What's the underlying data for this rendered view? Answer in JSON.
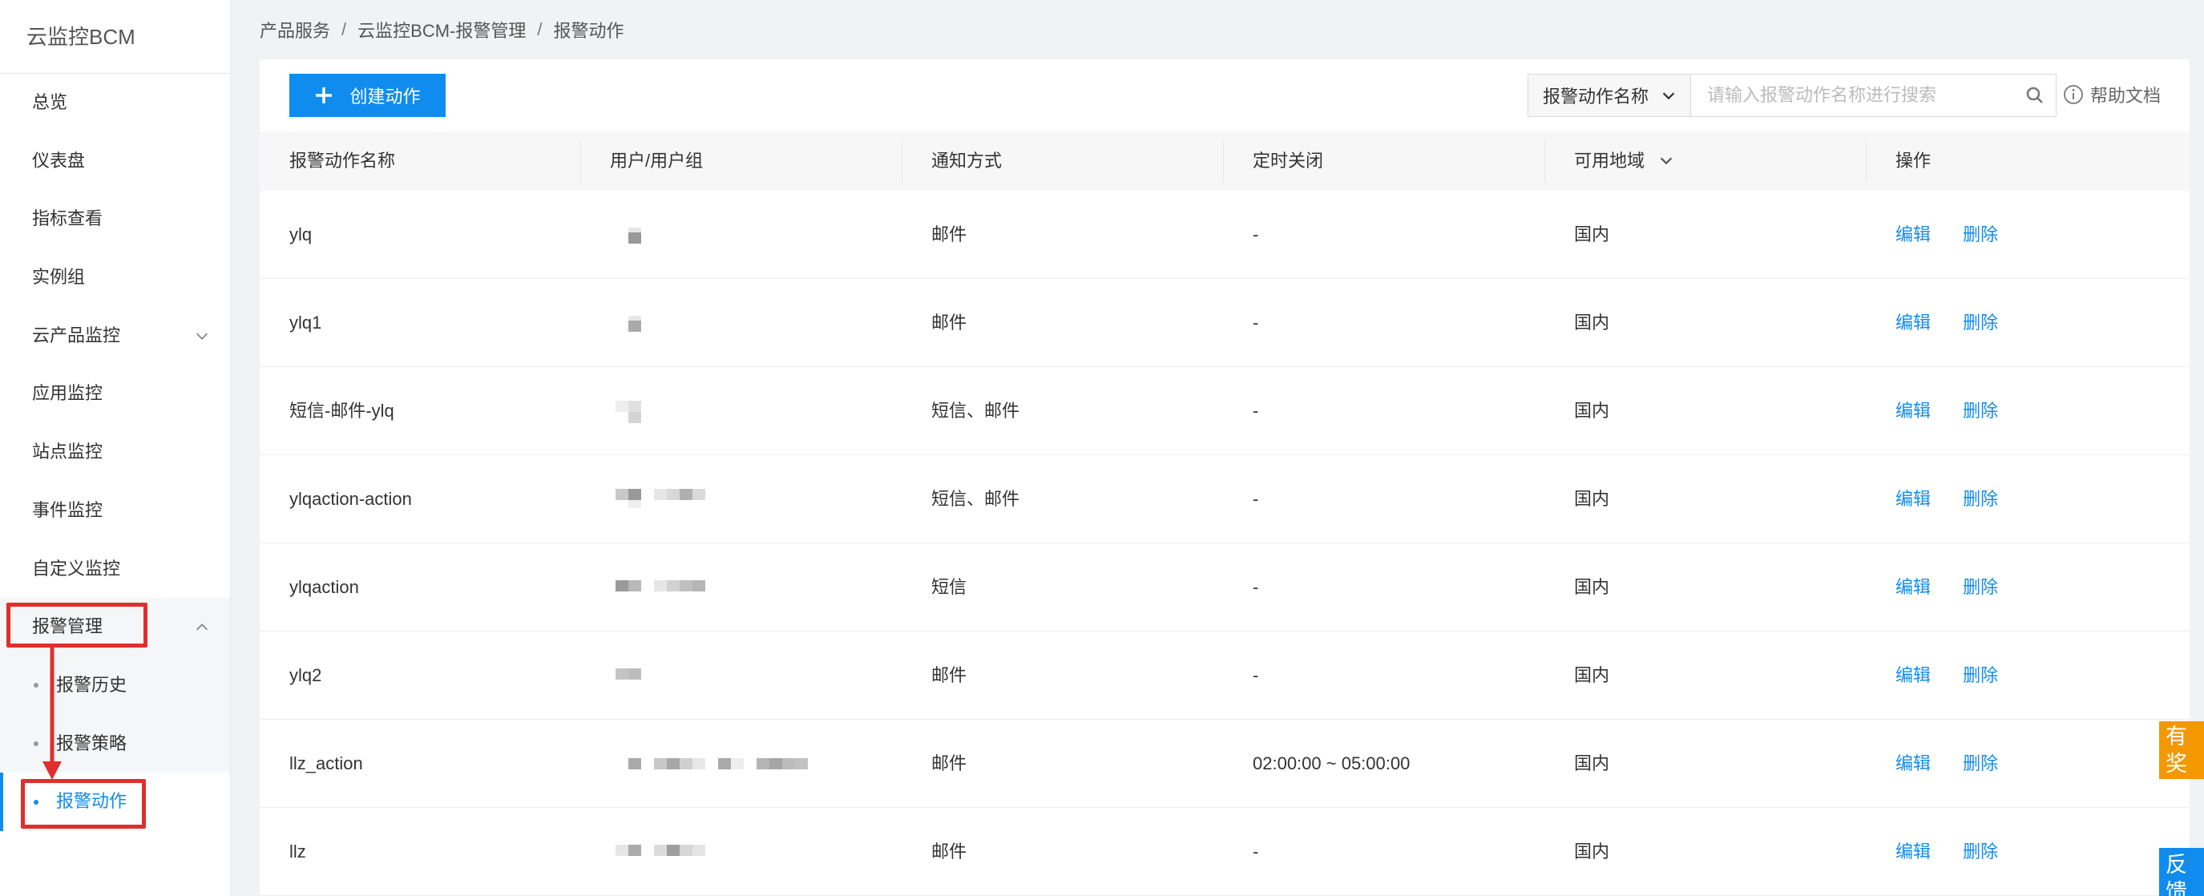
{
  "sidebar": {
    "brand": "云监控BCM",
    "items": [
      {
        "label": "总览"
      },
      {
        "label": "仪表盘"
      },
      {
        "label": "指标查看"
      },
      {
        "label": "实例组"
      },
      {
        "label": "云产品监控"
      },
      {
        "label": "应用监控"
      },
      {
        "label": "站点监控"
      },
      {
        "label": "事件监控"
      },
      {
        "label": "自定义监控"
      },
      {
        "label": "报警管理"
      }
    ],
    "alarm_sub": [
      {
        "label": "报警历史"
      },
      {
        "label": "报警策略"
      },
      {
        "label": "报警动作"
      }
    ]
  },
  "breadcrumb": {
    "items": [
      "产品服务",
      "云监控BCM-报警管理",
      "报警动作"
    ],
    "sep": "/"
  },
  "toolbar": {
    "create_label": "创建动作",
    "search_field": "报警动作名称",
    "search_placeholder": "请输入报警动作名称进行搜索",
    "help_label": "帮助文档"
  },
  "table": {
    "headers": [
      "报警动作名称",
      "用户/用户组",
      "通知方式",
      "定时关闭",
      "可用地域",
      "操作"
    ],
    "rows": [
      {
        "name": "ylq",
        "notify": "邮件",
        "schedule": "-",
        "region": "国内"
      },
      {
        "name": "ylq1",
        "notify": "邮件",
        "schedule": "-",
        "region": "国内"
      },
      {
        "name": "短信-邮件-ylq",
        "notify": "短信、邮件",
        "schedule": "-",
        "region": "国内"
      },
      {
        "name": "ylqaction-action",
        "notify": "短信、邮件",
        "schedule": "-",
        "region": "国内"
      },
      {
        "name": "ylqaction",
        "notify": "短信",
        "schedule": "-",
        "region": "国内"
      },
      {
        "name": "ylq2",
        "notify": "邮件",
        "schedule": "-",
        "region": "国内"
      },
      {
        "name": "llz_action",
        "notify": "邮件",
        "schedule": "02:00:00 ~ 05:00:00",
        "region": "国内"
      },
      {
        "name": "llz",
        "notify": "邮件",
        "schedule": "-",
        "region": "国内"
      }
    ],
    "edit_label": "编辑",
    "delete_label": "删除"
  },
  "float": {
    "survey_label": "有奖调研",
    "feedback_label": "反馈建议"
  },
  "colors": {
    "accent": "#108cee",
    "annotation": "#e02e2e",
    "survey": "#f39800"
  }
}
